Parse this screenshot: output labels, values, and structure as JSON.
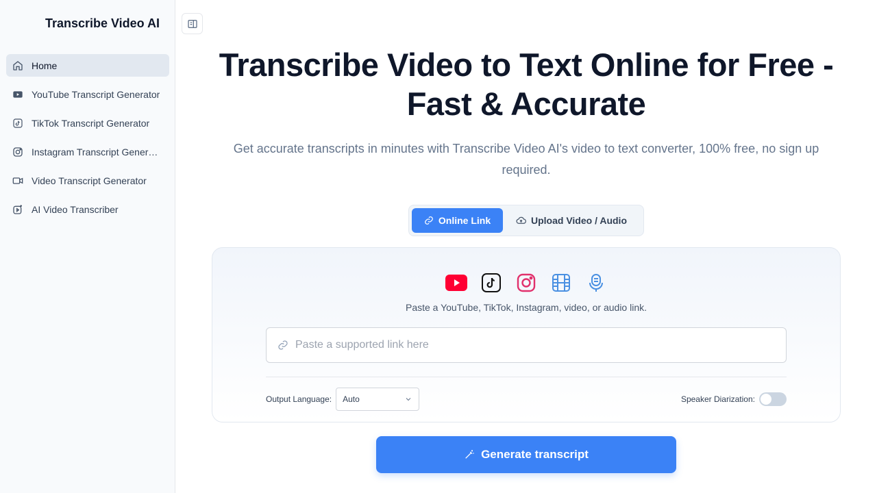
{
  "sidebar": {
    "brand": "Transcribe Video AI",
    "items": [
      {
        "label": "Home",
        "icon": "home-icon",
        "active": true
      },
      {
        "label": "YouTube Transcript Generator",
        "icon": "youtube-icon"
      },
      {
        "label": "TikTok Transcript Generator",
        "icon": "tiktok-icon"
      },
      {
        "label": "Instagram Transcript Generator",
        "icon": "instagram-icon"
      },
      {
        "label": "Video Transcript Generator",
        "icon": "video-icon"
      },
      {
        "label": "AI Video Transcriber",
        "icon": "ai-video-icon"
      }
    ]
  },
  "main": {
    "title_line1": "Transcribe Video to Text Online for Free -",
    "title_line2": "Fast & Accurate",
    "subtitle": "Get accurate transcripts in minutes with Transcribe Video AI's video to text converter, 100% free, no sign up required.",
    "tabs": {
      "online_link": "Online Link",
      "upload": "Upload Video / Audio"
    },
    "card": {
      "hint": "Paste a YouTube, TikTok, Instagram, video, or audio link.",
      "input_placeholder": "Paste a supported link here",
      "input_value": "",
      "output_language_label": "Output Language:",
      "output_language_value": "Auto",
      "speaker_diarization_label": "Speaker Diarization:",
      "speaker_diarization_on": false
    },
    "generate_button": "Generate transcript"
  },
  "colors": {
    "accent": "#3b82f6",
    "youtube": "#ff0033",
    "instagram": "#e1306c",
    "text_dark": "#0f172a"
  }
}
